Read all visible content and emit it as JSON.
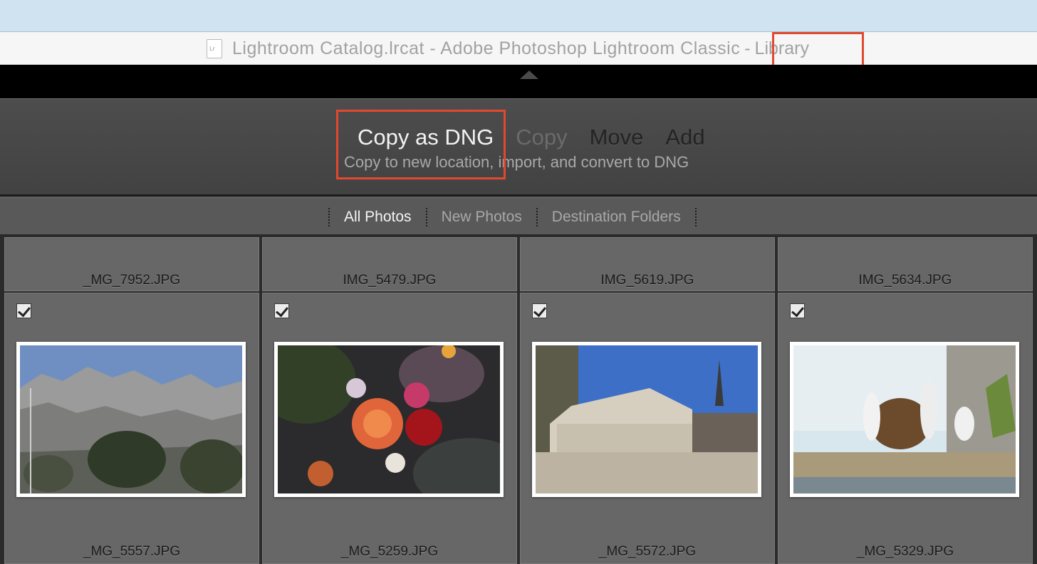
{
  "window": {
    "document_title": "Lightroom Catalog.lrcat - Adobe Photoshop Lightroom Classic",
    "separator": "-",
    "module": "Library"
  },
  "import_modes": {
    "items": [
      {
        "label": "Copy as DNG",
        "state": "active"
      },
      {
        "label": "Copy",
        "state": "dim"
      },
      {
        "label": "Move",
        "state": "inactive"
      },
      {
        "label": "Add",
        "state": "inactive"
      }
    ],
    "description": "Copy to new location, import, and convert to DNG"
  },
  "filters": {
    "items": [
      {
        "label": "All Photos",
        "active": true
      },
      {
        "label": "New Photos",
        "active": false
      },
      {
        "label": "Destination Folders",
        "active": false
      }
    ]
  },
  "grid": {
    "top_row": [
      {
        "filename": "_MG_7952.JPG"
      },
      {
        "filename": "IMG_5479.JPG"
      },
      {
        "filename": "IMG_5619.JPG"
      },
      {
        "filename": "IMG_5634.JPG"
      }
    ],
    "main_row": [
      {
        "filename": "_MG_5557.JPG",
        "checked": true,
        "subject": "mountain-landscape"
      },
      {
        "filename": "_MG_5259.JPG",
        "checked": true,
        "subject": "flower-bouquet"
      },
      {
        "filename": "_MG_5572.JPG",
        "checked": true,
        "subject": "building-plaza"
      },
      {
        "filename": "_MG_5329.JPG",
        "checked": true,
        "subject": "penguins"
      }
    ]
  },
  "colors": {
    "highlight": "#e0492f",
    "panel_dark": "#424242",
    "cell_bg": "#676767"
  }
}
